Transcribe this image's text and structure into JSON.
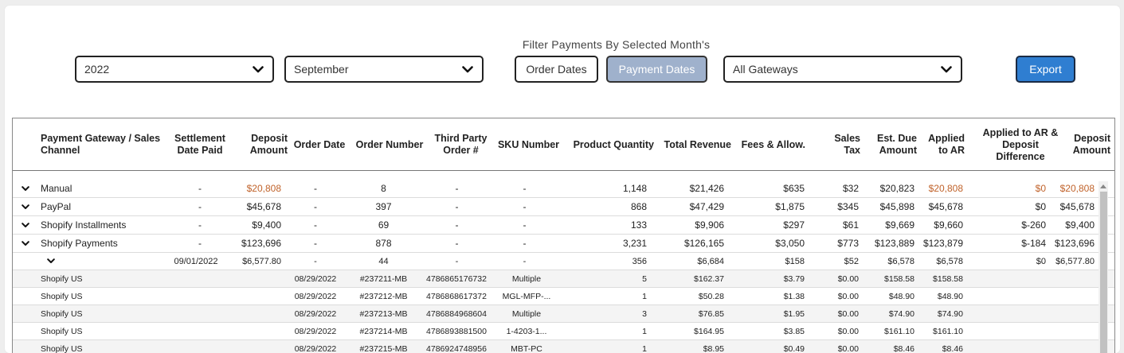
{
  "filter": {
    "title": "Filter Payments By Selected Month's",
    "year": "2022",
    "month": "September",
    "order_dates_label": "Order Dates",
    "payment_dates_label": "Payment Dates",
    "gateway": "All Gateways",
    "export_label": "Export"
  },
  "colors": {
    "accent": "#2f7ed1",
    "active_toggle": "#9fb1cc",
    "highlight": "#c0622a"
  },
  "table": {
    "headers": {
      "gateway": "Payment Gateway / Sales Channel",
      "settlement": "Settlement Date Paid",
      "deposit": "Deposit Amount",
      "order_date": "Order Date",
      "order_number": "Order Number",
      "third_party": "Third Party Order #",
      "sku": "SKU Number",
      "qty": "Product Quantity",
      "revenue": "Total Revenue",
      "fees": "Fees & Allow.",
      "tax": "Sales Tax",
      "est_due": "Est. Due Amount",
      "applied": "Applied to AR",
      "diff": "Applied to AR & Deposit Difference",
      "deposit2": "Deposit Amount"
    },
    "groups": [
      {
        "name": "Manual",
        "settlement": "-",
        "deposit": "$20,808",
        "order_date": "-",
        "order_number": "8",
        "third_party": "-",
        "sku": "-",
        "qty": "1,148",
        "revenue": "$21,426",
        "fees": "$635",
        "tax": "$32",
        "est_due": "$20,823",
        "applied": "$20,808",
        "diff": "$0",
        "deposit2": "$20,808"
      },
      {
        "name": "PayPal",
        "settlement": "-",
        "deposit": "$45,678",
        "order_date": "-",
        "order_number": "397",
        "third_party": "-",
        "sku": "-",
        "qty": "868",
        "revenue": "$47,429",
        "fees": "$1,875",
        "tax": "$345",
        "est_due": "$45,898",
        "applied": "$45,678",
        "diff": "$0",
        "deposit2": "$45,678"
      },
      {
        "name": "Shopify Installments",
        "settlement": "-",
        "deposit": "$9,400",
        "order_date": "-",
        "order_number": "69",
        "third_party": "-",
        "sku": "-",
        "qty": "133",
        "revenue": "$9,906",
        "fees": "$297",
        "tax": "$61",
        "est_due": "$9,669",
        "applied": "$9,660",
        "diff": "$-260",
        "deposit2": "$9,400"
      },
      {
        "name": "Shopify Payments",
        "settlement": "-",
        "deposit": "$123,696",
        "order_date": "-",
        "order_number": "878",
        "third_party": "-",
        "sku": "-",
        "qty": "3,231",
        "revenue": "$126,165",
        "fees": "$3,050",
        "tax": "$773",
        "est_due": "$123,889",
        "applied": "$123,879",
        "diff": "$-184",
        "deposit2": "$123,696"
      }
    ],
    "settlement_row": {
      "settlement": "09/01/2022",
      "deposit": "$6,577.80",
      "order_date": "-",
      "order_number": "44",
      "third_party": "-",
      "sku": "-",
      "qty": "356",
      "revenue": "$6,684",
      "fees": "$158",
      "tax": "$52",
      "est_due": "$6,578",
      "applied": "$6,578",
      "diff": "$0",
      "deposit2": "$6,577.80"
    },
    "orders": [
      {
        "channel": "Shopify US",
        "order_date": "08/29/2022",
        "order_number": "#237211-MB",
        "third_party": "4786865176732",
        "sku": "Multiple",
        "qty": "5",
        "revenue": "$162.37",
        "fees": "$3.79",
        "tax": "$0.00",
        "est_due": "$158.58",
        "applied": "$158.58"
      },
      {
        "channel": "Shopify US",
        "order_date": "08/29/2022",
        "order_number": "#237212-MB",
        "third_party": "4786868617372",
        "sku": "MGL-MFP-...",
        "qty": "1",
        "revenue": "$50.28",
        "fees": "$1.38",
        "tax": "$0.00",
        "est_due": "$48.90",
        "applied": "$48.90"
      },
      {
        "channel": "Shopify US",
        "order_date": "08/29/2022",
        "order_number": "#237213-MB",
        "third_party": "4786884968604",
        "sku": "Multiple",
        "qty": "3",
        "revenue": "$76.85",
        "fees": "$1.95",
        "tax": "$0.00",
        "est_due": "$74.90",
        "applied": "$74.90"
      },
      {
        "channel": "Shopify US",
        "order_date": "08/29/2022",
        "order_number": "#237214-MB",
        "third_party": "4786893881500",
        "sku": "1-4203-1...",
        "qty": "1",
        "revenue": "$164.95",
        "fees": "$3.85",
        "tax": "$0.00",
        "est_due": "$161.10",
        "applied": "$161.10"
      },
      {
        "channel": "Shopify US",
        "order_date": "08/29/2022",
        "order_number": "#237215-MB",
        "third_party": "4786924748956",
        "sku": "MBT-PC",
        "qty": "1",
        "revenue": "$8.95",
        "fees": "$0.49",
        "tax": "$0.00",
        "est_due": "$8.46",
        "applied": "$8.46"
      }
    ]
  }
}
